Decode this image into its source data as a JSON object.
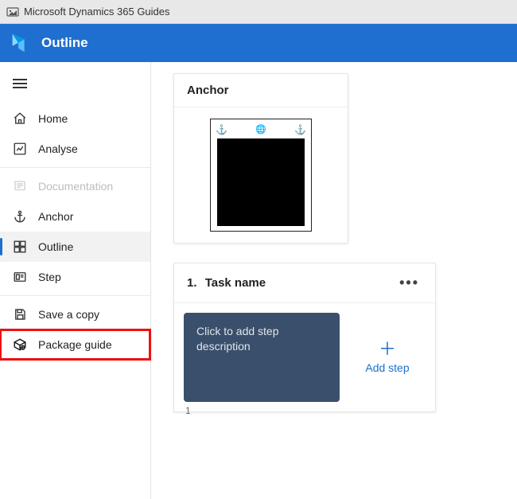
{
  "titlebar": {
    "app_name": "Microsoft Dynamics 365 Guides"
  },
  "header": {
    "title": "Outline"
  },
  "sidebar": {
    "items": [
      {
        "id": "home",
        "label": "Home"
      },
      {
        "id": "analyse",
        "label": "Analyse"
      },
      {
        "id": "documentation",
        "label": "Documentation",
        "disabled": true
      },
      {
        "id": "anchor",
        "label": "Anchor"
      },
      {
        "id": "outline",
        "label": "Outline",
        "selected": true
      },
      {
        "id": "step",
        "label": "Step"
      },
      {
        "id": "save-a-copy",
        "label": "Save a copy"
      },
      {
        "id": "package-guide",
        "label": "Package guide",
        "highlighted": true
      }
    ]
  },
  "main": {
    "anchor_card": {
      "title": "Anchor"
    },
    "task_card": {
      "index": "1.",
      "title": "Task name",
      "steps": [
        {
          "number": "1",
          "placeholder": "Click to add step description"
        }
      ],
      "add_step_label": "Add step"
    }
  }
}
